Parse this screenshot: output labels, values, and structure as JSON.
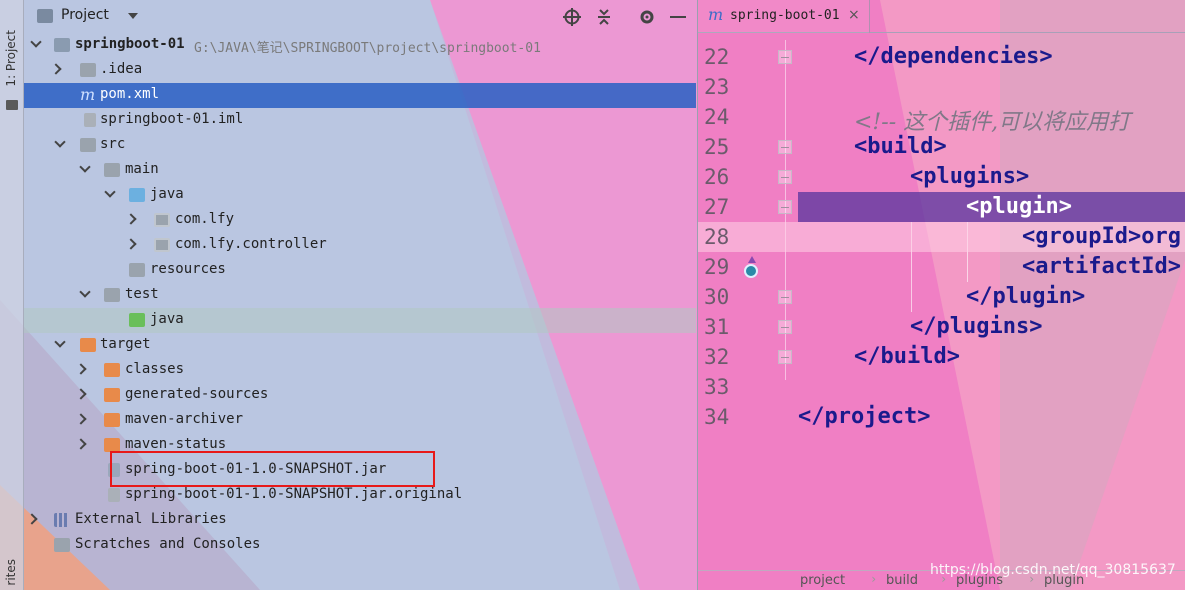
{
  "sidebar": {
    "project_tab": "1: Project",
    "favorites_tab": "rites"
  },
  "panel": {
    "title": "Project"
  },
  "tree": [
    {
      "label": "springboot-01",
      "path": "G:\\JAVA\\笔记\\SPRINGBOOT\\project\\springboot-01"
    },
    {
      "label": ".idea"
    },
    {
      "label": "pom.xml"
    },
    {
      "label": "springboot-01.iml"
    },
    {
      "label": "src"
    },
    {
      "label": "main"
    },
    {
      "label": "java"
    },
    {
      "label": "com.lfy"
    },
    {
      "label": "com.lfy.controller"
    },
    {
      "label": "resources"
    },
    {
      "label": "test"
    },
    {
      "label": "java"
    },
    {
      "label": "target"
    },
    {
      "label": "classes"
    },
    {
      "label": "generated-sources"
    },
    {
      "label": "maven-archiver"
    },
    {
      "label": "maven-status"
    },
    {
      "label": "spring-boot-01-1.0-SNAPSHOT.jar"
    },
    {
      "label": "spring-boot-01-1.0-SNAPSHOT.jar.original"
    },
    {
      "label": "External Libraries"
    },
    {
      "label": "Scratches and Consoles"
    }
  ],
  "editor": {
    "tab_m": "m",
    "tab_label": "spring-boot-01",
    "close_glyph": "×",
    "lines": [
      {
        "num": "22",
        "code": "</dependencies>"
      },
      {
        "num": "23",
        "code": ""
      },
      {
        "num": "24",
        "code": "<!-- 这个插件,可以将应用打"
      },
      {
        "num": "25",
        "code": "<build>"
      },
      {
        "num": "26",
        "code": "<plugins>"
      },
      {
        "num": "27",
        "code": "<plugin>"
      },
      {
        "num": "28",
        "code": "<groupId>org"
      },
      {
        "num": "29",
        "code": "<artifactId>"
      },
      {
        "num": "30",
        "code": "</plugin>"
      },
      {
        "num": "31",
        "code": "</plugins>"
      },
      {
        "num": "32",
        "code": "</build>"
      },
      {
        "num": "33",
        "code": ""
      },
      {
        "num": "34",
        "code": "</project>"
      }
    ],
    "breadcrumbs": [
      "project",
      "build",
      "plugins",
      "plugin"
    ],
    "watermark": "https://blog.csdn.net/qq_30815637"
  },
  "colors": {
    "selection": "#2e62c4",
    "red_box": "#e81919",
    "tag": "#1a1a8c"
  }
}
